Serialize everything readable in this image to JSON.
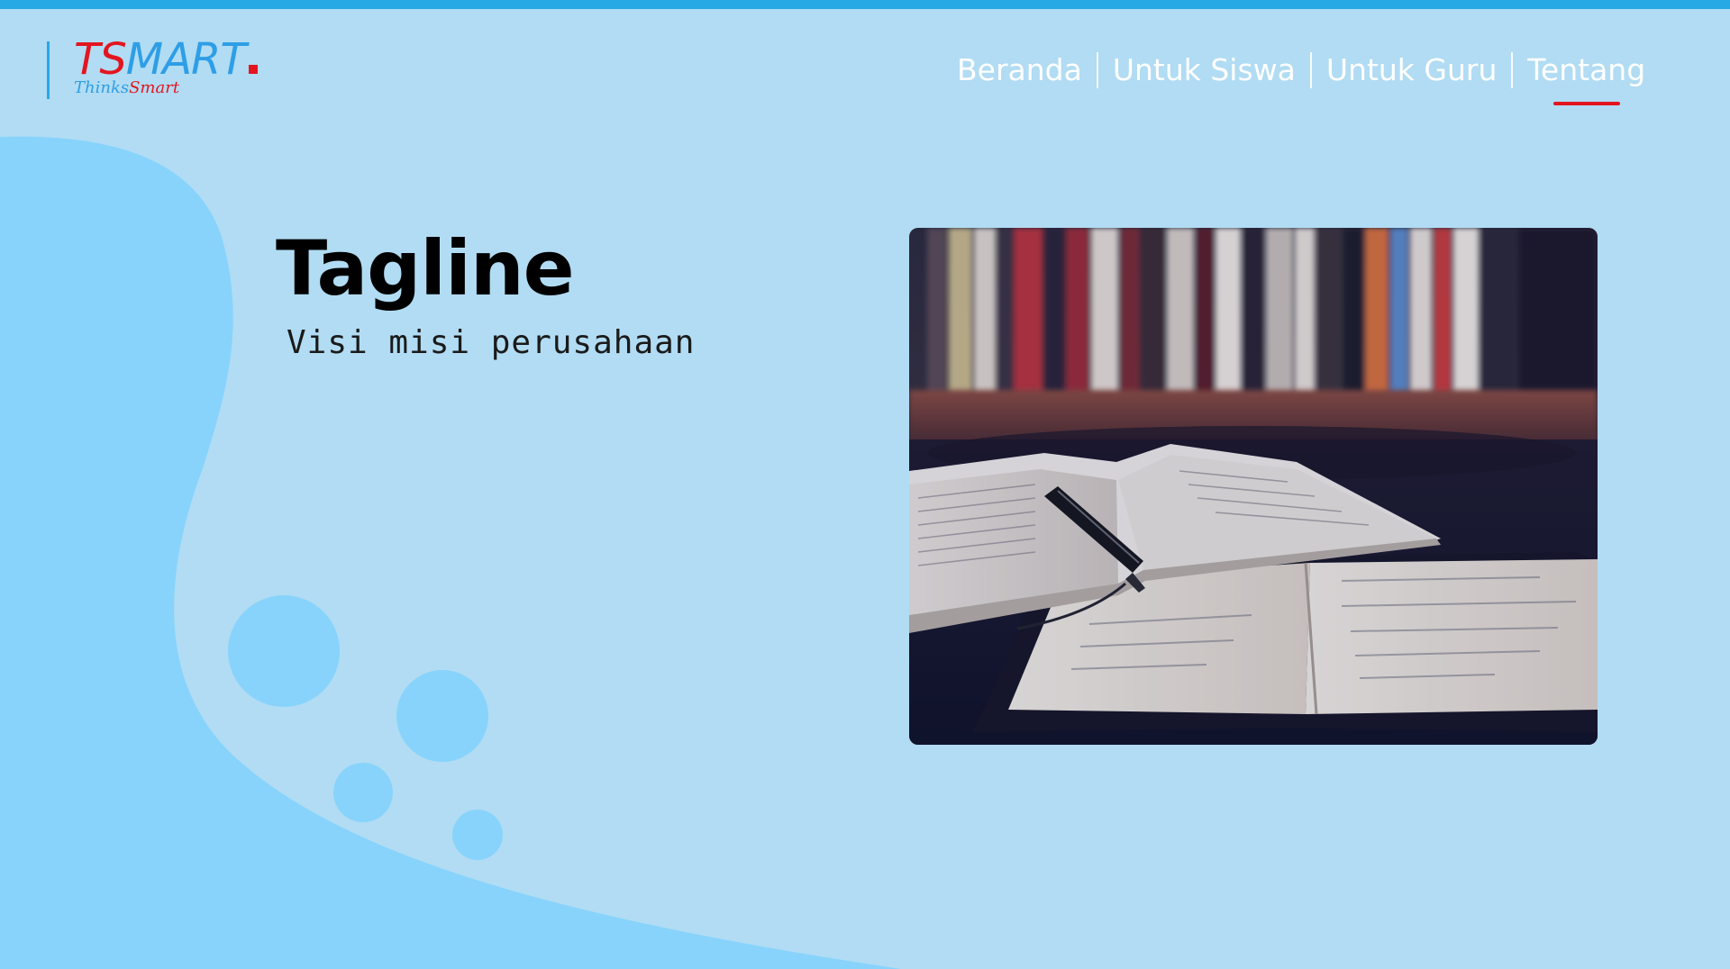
{
  "logo": {
    "ts": "TS",
    "mart": "MART",
    "sub_thinks": "Thinks",
    "sub_smart": "Smart"
  },
  "nav": {
    "items": [
      {
        "label": "Beranda"
      },
      {
        "label": "Untuk Siswa"
      },
      {
        "label": "Untuk Guru"
      },
      {
        "label": "Tentang"
      }
    ],
    "active_index": 3
  },
  "hero": {
    "title": "Tagline",
    "subtitle": "Visi misi perusahaan",
    "image_icon": "open-books-photo"
  },
  "colors": {
    "background": "#b1dcf3",
    "blob": "#87d3fc",
    "top_bar": "#27a9e6",
    "brand_red": "#e3151f",
    "brand_blue": "#2e9ee6",
    "nav_text": "#ffffff"
  }
}
